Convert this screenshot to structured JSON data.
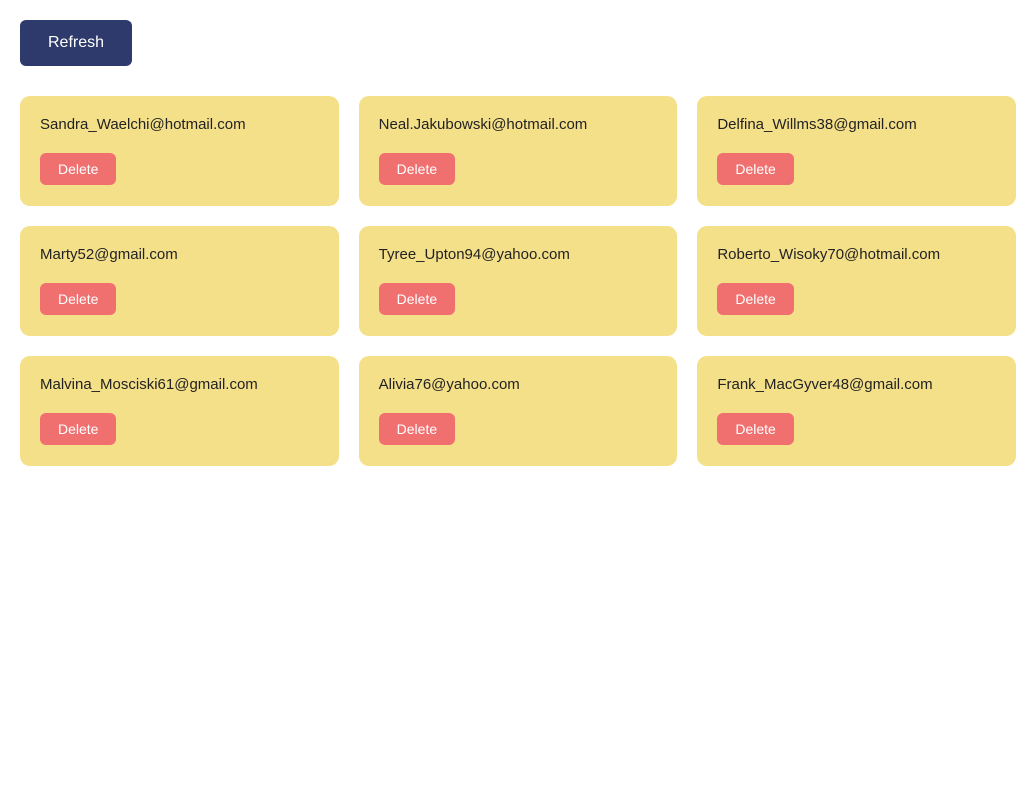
{
  "toolbar": {
    "refresh_label": "Refresh"
  },
  "cards": [
    {
      "email": "Sandra_Waelchi@hotmail.com",
      "delete_label": "Delete"
    },
    {
      "email": "Neal.Jakubowski@hotmail.com",
      "delete_label": "Delete"
    },
    {
      "email": "Delfina_Willms38@gmail.com",
      "delete_label": "Delete"
    },
    {
      "email": "Marty52@gmail.com",
      "delete_label": "Delete"
    },
    {
      "email": "Tyree_Upton94@yahoo.com",
      "delete_label": "Delete"
    },
    {
      "email": "Roberto_Wisoky70@hotmail.com",
      "delete_label": "Delete"
    },
    {
      "email": "Malvina_Mosciski61@gmail.com",
      "delete_label": "Delete"
    },
    {
      "email": "Alivia76@yahoo.com",
      "delete_label": "Delete"
    },
    {
      "email": "Frank_MacGyver48@gmail.com",
      "delete_label": "Delete"
    }
  ],
  "colors": {
    "refresh_bg": "#2d3a6b",
    "card_bg": "#f5e08a",
    "delete_bg": "#f07070"
  }
}
